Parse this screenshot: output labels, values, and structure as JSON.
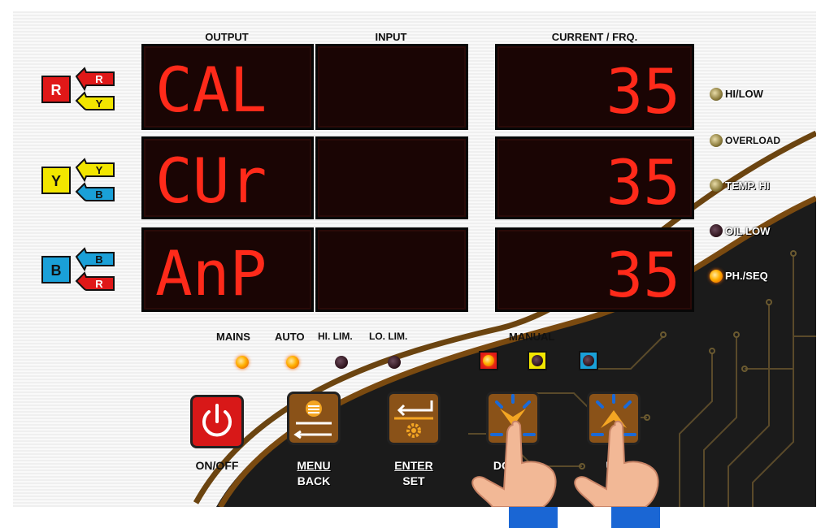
{
  "headers": {
    "output": "OUTPUT",
    "input": "INPUT",
    "current": "CURRENT / FRQ."
  },
  "phases": [
    {
      "main": "R",
      "top": "R",
      "bottom": "Y",
      "output": "CAL",
      "input": "",
      "current": "35"
    },
    {
      "main": "Y",
      "top": "Y",
      "bottom": "B",
      "output": "CUr",
      "input": "",
      "current": "35"
    },
    {
      "main": "B",
      "top": "B",
      "bottom": "R",
      "output": "AnP",
      "input": "",
      "current": "35"
    }
  ],
  "status_leds": [
    {
      "label": "HI/LOW",
      "state": "dim"
    },
    {
      "label": "OVERLOAD",
      "state": "dim"
    },
    {
      "label": "TEMP. HI",
      "state": "dim"
    },
    {
      "label": "OIL LOW",
      "state": "off"
    },
    {
      "label": "PH./SEQ",
      "state": "on"
    }
  ],
  "bottom_leds": [
    {
      "label": "MAINS",
      "state": "on"
    },
    {
      "label": "AUTO",
      "state": "on"
    },
    {
      "label": "HI. LIM.",
      "state": "off"
    },
    {
      "label": "LO. LIM.",
      "state": "off"
    }
  ],
  "manual": {
    "label": "MANUAL",
    "colors": [
      "#e01818",
      "#f2e600",
      "#1aa0d8"
    ]
  },
  "buttons": {
    "onoff": "ON/OFF",
    "menu": "MENU",
    "back": "BACK",
    "enter": "ENTER",
    "set": "SET",
    "down": "DOWN",
    "up": "UP"
  },
  "colors": {
    "red": "#e01818",
    "yellow": "#f2e600",
    "blue": "#1aa0d8",
    "segment": "#ff2a1a",
    "brown": "#7a4a10"
  }
}
